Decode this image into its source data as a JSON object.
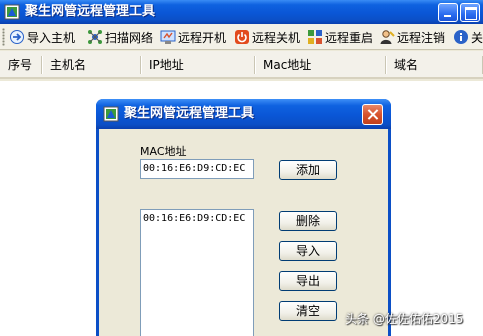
{
  "main_window": {
    "title": "聚生网管远程管理工具"
  },
  "toolbar": {
    "items": [
      {
        "label": "导入主机",
        "icon": "import-host-icon"
      },
      {
        "label": "扫描网络",
        "icon": "scan-network-icon"
      },
      {
        "label": "远程开机",
        "icon": "remote-power-on-icon"
      },
      {
        "label": "远程关机",
        "icon": "remote-shutdown-icon"
      },
      {
        "label": "远程重启",
        "icon": "remote-restart-icon"
      },
      {
        "label": "远程注销",
        "icon": "remote-logoff-icon"
      },
      {
        "label": "关",
        "icon": "info-icon"
      }
    ]
  },
  "table": {
    "columns": [
      "序号",
      "主机名",
      "IP地址",
      "Mac地址",
      "域名"
    ]
  },
  "dialog": {
    "title": "聚生网管远程管理工具",
    "mac_label": "MAC地址",
    "mac_input_value": "00:16:E6:D9:CD:EC",
    "mac_list": [
      "00:16:E6:D9:CD:EC"
    ],
    "buttons": {
      "add": "添加",
      "delete": "删除",
      "import": "导入",
      "export": "导出",
      "clear": "清空"
    }
  },
  "watermark": {
    "text": "头条 @佐佐佑佑2015"
  },
  "colors": {
    "titlebar_blue": "#0a56d6",
    "close_red": "#d8532e",
    "window_bg": "#ece9d8"
  }
}
